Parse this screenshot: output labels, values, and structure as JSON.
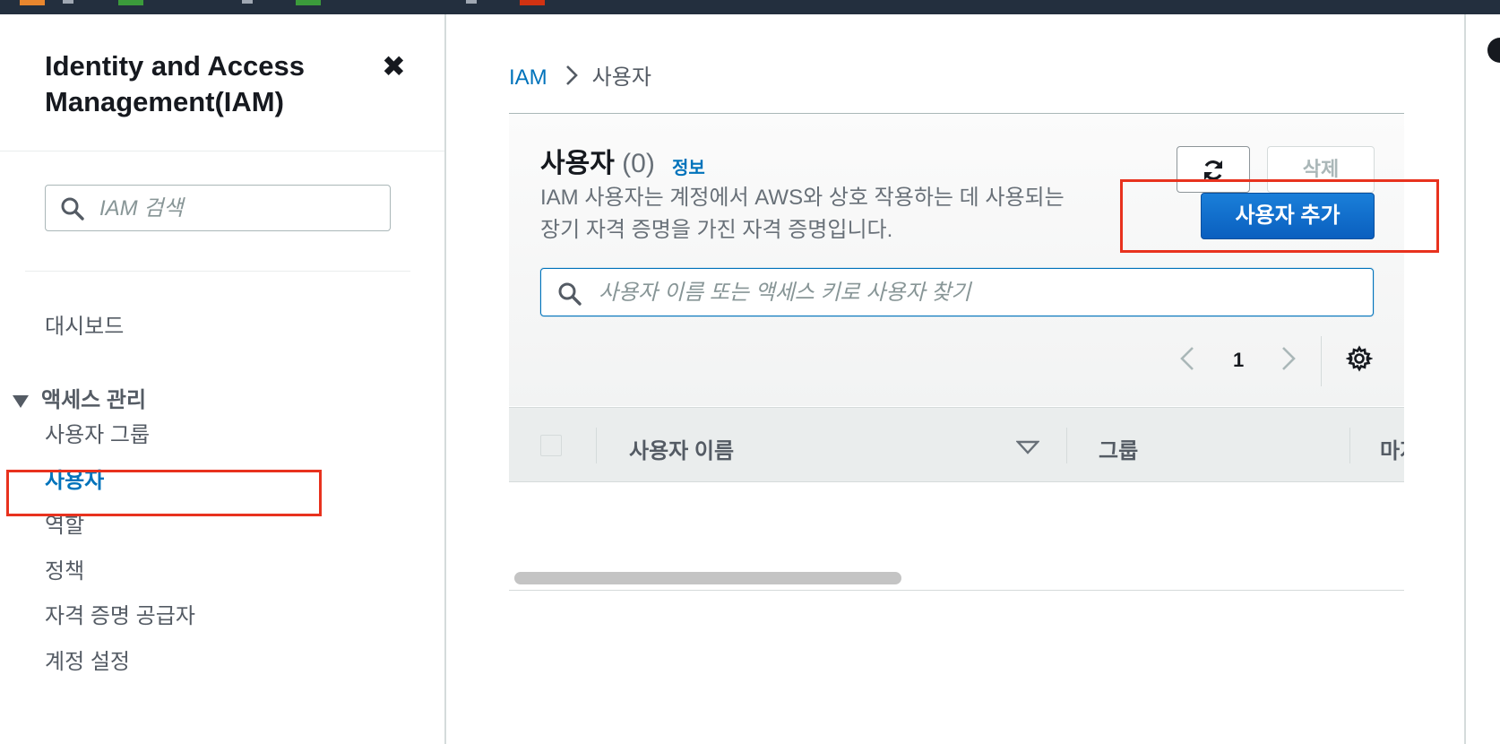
{
  "sidebar": {
    "title": "Identity and Access Management(IAM)",
    "close_glyph": "✖",
    "search_placeholder": "IAM 검색",
    "dashboard": "대시보드",
    "access_section": "액세스 관리",
    "items": [
      {
        "label": "사용자 그룹"
      },
      {
        "label": "사용자",
        "active": true
      },
      {
        "label": "역할"
      },
      {
        "label": "정책"
      },
      {
        "label": "자격 증명 공급자"
      },
      {
        "label": "계정 설정"
      }
    ]
  },
  "breadcrumb": {
    "root": "IAM",
    "current": "사용자"
  },
  "panel": {
    "title": "사용자",
    "count": "(0)",
    "info_link": "정보",
    "description": "IAM 사용자는 계정에서 AWS와 상호 작용하는 데 사용되는 장기 자격 증명을 가진 자격 증명입니다.",
    "delete_label": "삭제",
    "add_label": "사용자 추가",
    "search_placeholder": "사용자 이름 또는 액세스 키로 사용자 찾기",
    "page": "1"
  },
  "table": {
    "columns": [
      "사용자 이름",
      "그룹",
      "마지"
    ]
  },
  "colors": {
    "link": "#0073bb",
    "primary_button": "#0972d3",
    "highlight": "#e8321e",
    "topbar": "#232f3e"
  },
  "icons": [
    "close-icon",
    "search-icon",
    "chevron-right-icon",
    "refresh-icon",
    "chevron-left-icon",
    "gear-icon",
    "sort-down-icon",
    "caret-down-icon",
    "info-icon"
  ]
}
